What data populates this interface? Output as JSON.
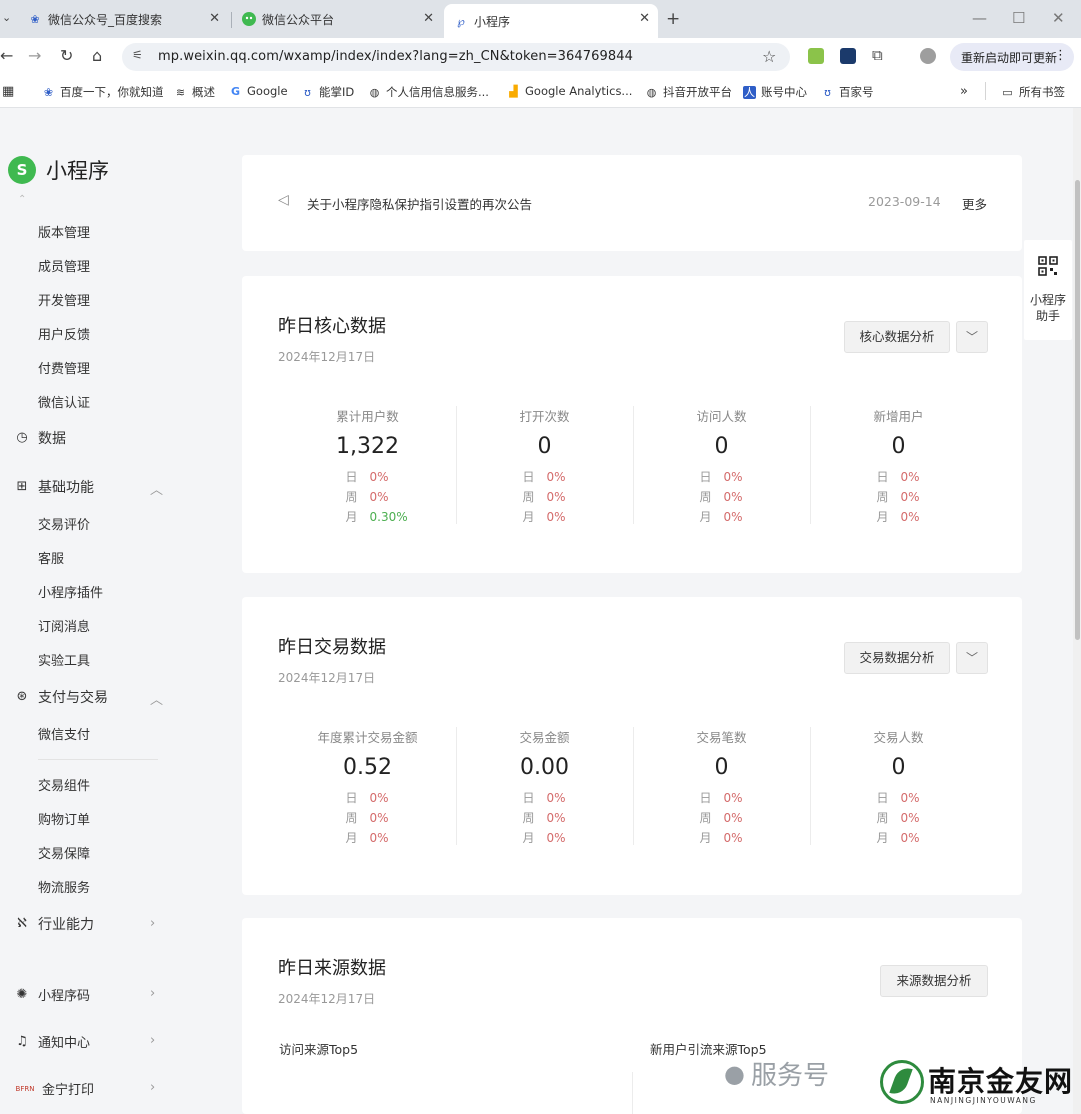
{
  "browser": {
    "tabs": [
      {
        "label": "微信公众号_百度搜索",
        "active": false
      },
      {
        "label": "微信公众平台",
        "active": false
      },
      {
        "label": "小程序",
        "active": true
      }
    ],
    "url": "mp.weixin.qq.com/wxamp/index/index?lang=zh_CN&token=364769844",
    "update_button": "重新启动即可更新",
    "bookmarks": [
      "百度一下，你就知道",
      "概述",
      "Google",
      "能掌ID",
      "个人信用信息服务...",
      "Google Analytics...",
      "抖音开放平台",
      "账号中心",
      "百家号"
    ],
    "all_bookmarks": "所有书签",
    "bookmarks_overflow": "»"
  },
  "sidebar": {
    "logo_text": "小程序",
    "top_items": [
      "版本管理",
      "成员管理",
      "开发管理",
      "用户反馈",
      "付费管理",
      "微信认证"
    ],
    "data_group": "数据",
    "basic_group": "基础功能",
    "basic_items": [
      "交易评价",
      "客服",
      "小程序插件",
      "订阅消息",
      "实验工具"
    ],
    "pay_group": "支付与交易",
    "pay_items": [
      "微信支付",
      "交易组件",
      "购物订单",
      "交易保障",
      "物流服务"
    ],
    "industry_group": "行业能力",
    "qrcode_group": "小程序码",
    "notice_group": "通知中心",
    "account_group": "金宁打印",
    "account_badge": "BFRN"
  },
  "notice": {
    "text": "关于小程序隐私保护指引设置的再次公告",
    "date": "2023-09-14",
    "more": "更多"
  },
  "core": {
    "title": "昨日核心数据",
    "date": "2024年12月17日",
    "analysis_button": "核心数据分析",
    "metrics": [
      {
        "label": "累计用户数",
        "value": "1,322",
        "day": "0%",
        "week": "0%",
        "month": "0.30%"
      },
      {
        "label": "打开次数",
        "value": "0",
        "day": "0%",
        "week": "0%",
        "month": "0%"
      },
      {
        "label": "访问人数",
        "value": "0",
        "day": "0%",
        "week": "0%",
        "month": "0%"
      },
      {
        "label": "新增用户",
        "value": "0",
        "day": "0%",
        "week": "0%",
        "month": "0%"
      }
    ]
  },
  "trade": {
    "title": "昨日交易数据",
    "date": "2024年12月17日",
    "analysis_button": "交易数据分析",
    "metrics": [
      {
        "label": "年度累计交易金额",
        "value": "0.52",
        "day": "0%",
        "week": "0%",
        "month": "0%"
      },
      {
        "label": "交易金额",
        "value": "0.00",
        "day": "0%",
        "week": "0%",
        "month": "0%"
      },
      {
        "label": "交易笔数",
        "value": "0",
        "day": "0%",
        "week": "0%",
        "month": "0%"
      },
      {
        "label": "交易人数",
        "value": "0",
        "day": "0%",
        "week": "0%",
        "month": "0%"
      }
    ]
  },
  "source": {
    "title": "昨日来源数据",
    "date": "2024年12月17日",
    "analysis_button": "来源数据分析",
    "visit_top": "访问来源Top5",
    "new_user_top": "新用户引流来源Top5"
  },
  "row_labels": {
    "day": "日",
    "week": "周",
    "month": "月"
  },
  "helper": {
    "label": "小程序助手"
  },
  "watermarks": {
    "service": "服务号",
    "site_name": "南京金友网",
    "site_pinyin": "NANJINGJINYOUWANG"
  },
  "colors": {
    "brand_green": "#3fb950",
    "down_red": "#d46b6b",
    "up_green": "#4caf50"
  }
}
